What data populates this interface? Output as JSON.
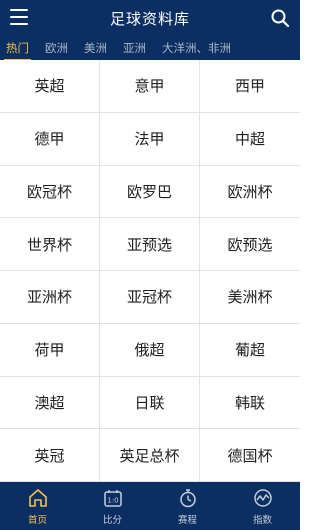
{
  "header": {
    "title": "足球资料库",
    "menu_icon": "hamburger-icon",
    "search_icon": "search-icon"
  },
  "tabs": [
    {
      "label": "热门",
      "active": true
    },
    {
      "label": "欧洲",
      "active": false
    },
    {
      "label": "美洲",
      "active": false
    },
    {
      "label": "亚洲",
      "active": false
    },
    {
      "label": "大洋洲、非洲",
      "active": false
    }
  ],
  "leagues": [
    "英超",
    "意甲",
    "西甲",
    "德甲",
    "法甲",
    "中超",
    "欧冠杯",
    "欧罗巴",
    "欧洲杯",
    "世界杯",
    "亚预选",
    "欧预选",
    "亚洲杯",
    "亚冠杯",
    "美洲杯",
    "荷甲",
    "俄超",
    "葡超",
    "澳超",
    "日联",
    "韩联",
    "英冠",
    "英足总杯",
    "德国杯"
  ],
  "bottom_nav": [
    {
      "label": "首页",
      "icon": "home-icon",
      "active": true
    },
    {
      "label": "比分",
      "icon": "scoreboard-icon",
      "active": false
    },
    {
      "label": "赛程",
      "icon": "stopwatch-icon",
      "active": false
    },
    {
      "label": "指数",
      "icon": "chart-icon",
      "active": false
    }
  ],
  "colors": {
    "header_bg": "#0b2f63",
    "accent": "#f1c14e"
  }
}
